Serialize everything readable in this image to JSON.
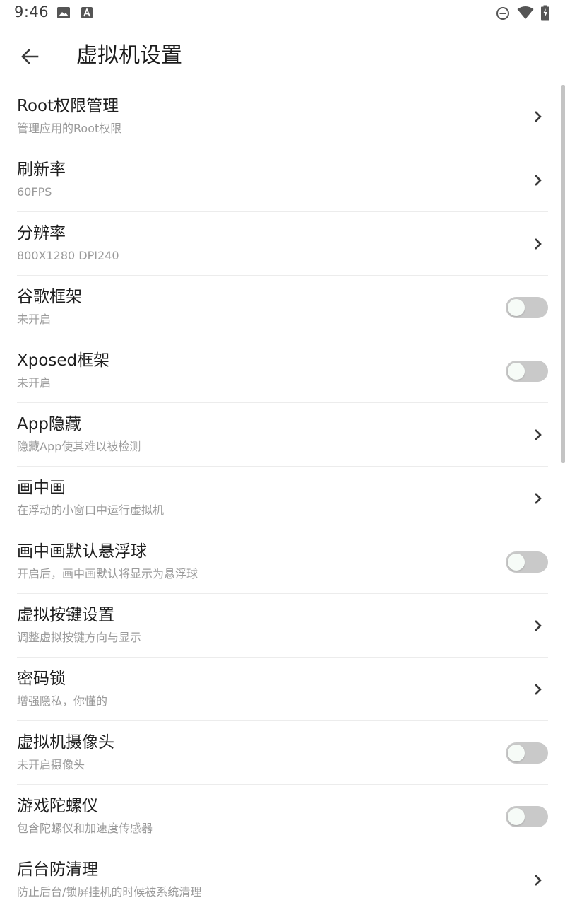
{
  "status_bar": {
    "time": "9:46",
    "icons": [
      "image-icon",
      "font-icon",
      "do-not-disturb-icon",
      "wifi-icon",
      "battery-charging-icon"
    ]
  },
  "toolbar": {
    "back_icon": "arrow-left-icon",
    "title": "虚拟机设置"
  },
  "colors": {
    "toggle_off_track": "#c9c9c9",
    "toggle_off_knob": "#f6fbf7",
    "title_text": "#1f1f1f",
    "subtitle_text": "#9a9a9a"
  },
  "settings": [
    {
      "name": "root-permission",
      "title": "Root权限管理",
      "subtitle": "管理应用的Root权限",
      "control": "chevron"
    },
    {
      "name": "refresh-rate",
      "title": "刷新率",
      "subtitle": "60FPS",
      "control": "chevron"
    },
    {
      "name": "resolution",
      "title": "分辨率",
      "subtitle": "800X1280 DPI240",
      "control": "chevron"
    },
    {
      "name": "google-framework",
      "title": "谷歌框架",
      "subtitle": "未开启",
      "control": "toggle",
      "on": false
    },
    {
      "name": "xposed-framework",
      "title": "Xposed框架",
      "subtitle": "未开启",
      "control": "toggle",
      "on": false
    },
    {
      "name": "app-hide",
      "title": "App隐藏",
      "subtitle": "隐藏App使其难以被检测",
      "control": "chevron"
    },
    {
      "name": "picture-in-picture",
      "title": "画中画",
      "subtitle": "在浮动的小窗口中运行虚拟机",
      "control": "chevron"
    },
    {
      "name": "pip-floating-ball",
      "title": "画中画默认悬浮球",
      "subtitle": "开启后，画中画默认将显示为悬浮球",
      "control": "toggle",
      "on": false
    },
    {
      "name": "virtual-keys",
      "title": "虚拟按键设置",
      "subtitle": "调整虚拟按键方向与显示",
      "control": "chevron"
    },
    {
      "name": "password-lock",
      "title": "密码锁",
      "subtitle": "增强隐私，你懂的",
      "control": "chevron"
    },
    {
      "name": "vm-camera",
      "title": "虚拟机摄像头",
      "subtitle": "未开启摄像头",
      "control": "toggle",
      "on": false
    },
    {
      "name": "game-gyroscope",
      "title": "游戏陀螺仪",
      "subtitle": "包含陀螺仪和加速度传感器",
      "control": "toggle",
      "on": false
    },
    {
      "name": "background-protect",
      "title": "后台防清理",
      "subtitle": "防止后台/锁屏挂机的时候被系统清理",
      "control": "chevron"
    }
  ]
}
